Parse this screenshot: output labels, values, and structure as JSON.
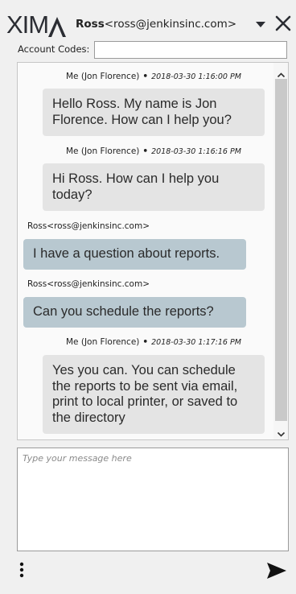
{
  "header": {
    "logo_text": "XIMA",
    "logo_prefix": "XIM",
    "contact_name": "Ross",
    "contact_email": "<ross@jenkinsinc.com>"
  },
  "account": {
    "label": "Account Codes:",
    "value": ""
  },
  "messages": [
    {
      "sender": "Me (Jon Florence)",
      "timestamp": "2018-03-30 1:16:00 PM",
      "text": "Hello Ross. My name is Jon Florence. How can I help you?",
      "from_me": true
    },
    {
      "sender": "Me (Jon Florence)",
      "timestamp": "2018-03-30 1:16:16 PM",
      "text": "Hi Ross. How can I help you today?",
      "from_me": true
    },
    {
      "sender": "Ross<ross@jenkinsinc.com>",
      "timestamp": "",
      "text": "I have a question about reports.",
      "from_me": false
    },
    {
      "sender": "Ross<ross@jenkinsinc.com>",
      "timestamp": "",
      "text": "Can you schedule the reports?",
      "from_me": false
    },
    {
      "sender": "Me (Jon Florence)",
      "timestamp": "2018-03-30 1:17:16 PM",
      "text": "Yes you can. You can schedule the reports to be sent via email, print to local printer, or saved to the directory",
      "from_me": true
    }
  ],
  "separator": "•",
  "composer": {
    "placeholder": "Type your message here",
    "value": ""
  },
  "icons": {
    "dropdown": "chevron-down-icon",
    "close": "close-icon",
    "scroll_up": "scroll-up-icon",
    "scroll_down": "scroll-down-icon",
    "menu": "vertical-dots-icon",
    "send": "send-icon"
  },
  "colors": {
    "my_bubble": "#e4e4e4",
    "their_bubble": "#b8c8d0",
    "brand": "#2b2d33"
  }
}
